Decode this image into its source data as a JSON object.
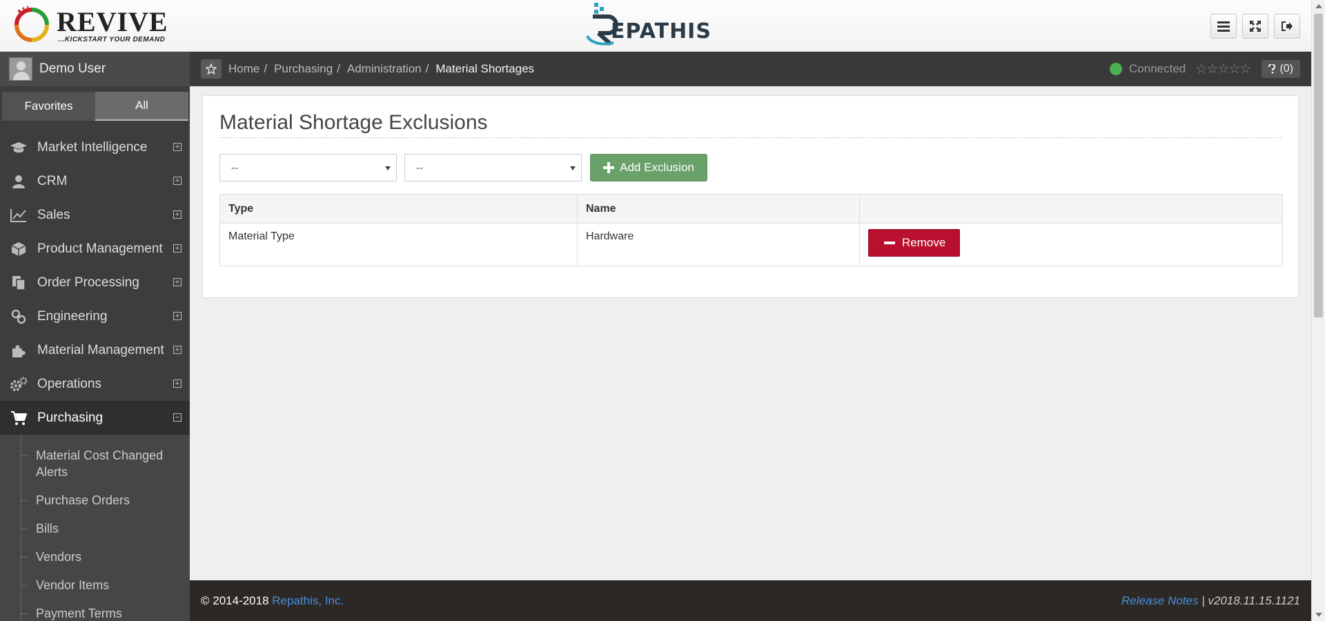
{
  "header": {
    "revive_logo_text": "REVIVE",
    "revive_tagline": "...KICKSTART YOUR DEMAND",
    "repathis_logo_text": "EPATHIS",
    "buttons": [
      "menu-icon",
      "expand-icon",
      "sign-out-icon"
    ]
  },
  "sidebar": {
    "user": "Demo User",
    "tabs": {
      "favorites": "Favorites",
      "all": "All"
    },
    "items": [
      {
        "label": "Market Intelligence",
        "icon": "graduation-cap-icon"
      },
      {
        "label": "CRM",
        "icon": "user-icon"
      },
      {
        "label": "Sales",
        "icon": "line-chart-icon"
      },
      {
        "label": "Product Management",
        "icon": "cube-icon"
      },
      {
        "label": "Order Processing",
        "icon": "copy-icon"
      },
      {
        "label": "Engineering",
        "icon": "link-icon"
      },
      {
        "label": "Material Management",
        "icon": "puzzle-icon"
      },
      {
        "label": "Operations",
        "icon": "cogs-icon"
      },
      {
        "label": "Purchasing",
        "icon": "cart-icon"
      }
    ],
    "sub_items": [
      "Material Cost Changed Alerts",
      "Purchase Orders",
      "Bills",
      "Vendors",
      "Vendor Items",
      "Payment Terms"
    ]
  },
  "breadcrumb": {
    "items": [
      "Home",
      "Purchasing",
      "Administration",
      "Material Shortages"
    ],
    "separator": "/",
    "status": "Connected",
    "stars": "☆☆☆☆☆",
    "help": "(0)"
  },
  "main": {
    "title": "Material Shortage Exclusions",
    "select1": "--",
    "select2": "--",
    "add_button": "Add Exclusion",
    "table": {
      "headers": [
        "Type",
        "Name",
        ""
      ],
      "rows": [
        {
          "type": "Material Type",
          "name": "Hardware",
          "action": "Remove"
        }
      ]
    }
  },
  "footer": {
    "copyright": "© 2014-2018",
    "company": "Repathis, Inc.",
    "release_notes": "Release Notes",
    "version": "| v2018.11.15.1121"
  },
  "colors": {
    "sidebar_bg": "#3d3d3d",
    "add_green": "#6aa06a",
    "remove_red": "#b8102e",
    "link_blue": "#4a90d9"
  }
}
